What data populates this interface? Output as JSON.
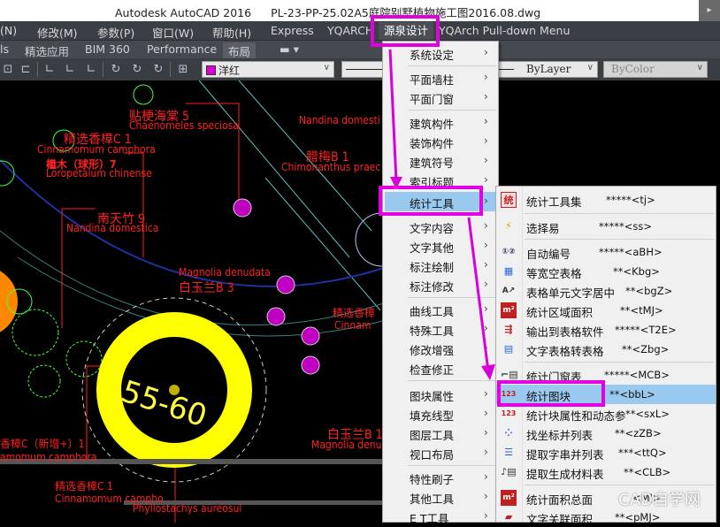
{
  "window": {
    "app_title": "Autodesk AutoCAD 2016",
    "file_name": "PL-23-PP-25.02A5庭院别墅植物施工图2016.08.dwg"
  },
  "menubar": {
    "items": [
      "(N)",
      "修改(M)",
      "参数(P)",
      "窗口(W)",
      "帮助(H)",
      "Express",
      "YQARCH",
      "源泉设计",
      "YQArch Pull-down Menu"
    ],
    "active": "源泉设计"
  },
  "ribbon_tabs": {
    "items": [
      "ls",
      "精选应用",
      "BIM 360",
      "Performance",
      "布局"
    ],
    "active": "布局"
  },
  "toolbar": {
    "layer_color": "洋红",
    "layer_color_hex": "#d600d6",
    "linetype": "ByLayer",
    "plot_style": "ByColor"
  },
  "main_menu": {
    "items": [
      {
        "label": "系统设定",
        "has_submenu": true
      },
      {
        "label": "平面墙柱",
        "has_submenu": true
      },
      {
        "label": "平面门窗",
        "has_submenu": true
      },
      {
        "label": "建筑构件",
        "has_submenu": true
      },
      {
        "label": "装饰构件",
        "has_submenu": true
      },
      {
        "label": "建筑符号",
        "has_submenu": true
      },
      {
        "label": "索引标题",
        "has_submenu": true
      },
      {
        "label": "统计工具",
        "has_submenu": true,
        "highlighted": true
      },
      {
        "label": "文字内容",
        "has_submenu": true
      },
      {
        "label": "文字其他",
        "has_submenu": true
      },
      {
        "label": "标注绘制",
        "has_submenu": true
      },
      {
        "label": "标注修改",
        "has_submenu": true
      },
      {
        "label": "曲线工具",
        "has_submenu": true
      },
      {
        "label": "特殊工具",
        "has_submenu": true
      },
      {
        "label": "修改增强",
        "has_submenu": true
      },
      {
        "label": "检查修正",
        "has_submenu": false
      },
      {
        "label": "图块属性",
        "has_submenu": true
      },
      {
        "label": "填充线型",
        "has_submenu": true
      },
      {
        "label": "图层工具",
        "has_submenu": true
      },
      {
        "label": "视口布局",
        "has_submenu": true
      },
      {
        "label": "特性刷子",
        "has_submenu": true
      },
      {
        "label": "其他工具",
        "has_submenu": true
      },
      {
        "label": "E T工具",
        "has_submenu": true
      }
    ],
    "arrow": "›"
  },
  "submenu": {
    "items": [
      {
        "label": "统计工具集",
        "shortcut": "*****<tj>",
        "icon": "stats-tool-icon"
      },
      {
        "label": "选择易",
        "shortcut": "*****<ss>",
        "icon": "lightning-select-icon"
      },
      {
        "label": "自动编号",
        "shortcut": "*****<aBH>",
        "icon": "auto-number-icon"
      },
      {
        "label": "等宽空表格",
        "shortcut": "**<Kbg>",
        "icon": "table-icon"
      },
      {
        "label": "表格单元文字居中",
        "shortcut": "**<bgZ>",
        "icon": "text-center-icon"
      },
      {
        "label": "统计区域面积",
        "shortcut": "**<tMJ>",
        "icon": "area-icon"
      },
      {
        "label": "输出到表格软件",
        "shortcut": "*****<T2E>",
        "icon": "export-table-icon"
      },
      {
        "label": "文字表格转表格",
        "shortcut": "**<Zbg>",
        "icon": "convert-table-icon"
      },
      {
        "label": "统计门窗表",
        "shortcut": "*****<MCB>",
        "icon": "door-window-icon"
      },
      {
        "label": "统计图块",
        "shortcut": "**<bbL>",
        "icon": "block-count-icon",
        "highlighted": true
      },
      {
        "label": "统计块属性和动态参",
        "shortcut": "**<sxL>",
        "icon": "block-attr-icon"
      },
      {
        "label": "找坐标并列表",
        "shortcut": "**<zZB>",
        "icon": "coordinate-list-icon"
      },
      {
        "label": "提取字串并列表",
        "shortcut": "***<ttQ>",
        "icon": "extract-string-icon"
      },
      {
        "label": "提取生成材料表",
        "shortcut": "**<CLB>",
        "icon": "material-table-icon"
      },
      {
        "label": "统计面积总面",
        "shortcut": "<MJ>",
        "icon": "total-area-icon"
      },
      {
        "label": "文字关联面积",
        "shortcut": "**<pMJ>",
        "icon": "text-area-icon"
      }
    ]
  },
  "drawing": {
    "labels": [
      {
        "text": "贴梗海棠 5",
        "color": "#ff2020"
      },
      {
        "text": "Chaenomeles speciosa",
        "color": "#ff2020"
      },
      {
        "text": "精选香樟C 1",
        "color": "#ff2020"
      },
      {
        "text": "Cinnamomum camphora",
        "color": "#ff2020"
      },
      {
        "text": "檵木（球形）7",
        "color": "#ff2020"
      },
      {
        "text": "Loropetalum chinense",
        "color": "#ff2020"
      },
      {
        "text": "南天竹 9",
        "color": "#ff2020"
      },
      {
        "text": "Nandina domestica",
        "color": "#ff2020"
      },
      {
        "text": "Nandina domesti",
        "color": "#ff2020"
      },
      {
        "text": "腊梅B 1",
        "color": "#ff2020"
      },
      {
        "text": "Chimonanthus praec",
        "color": "#ff2020"
      },
      {
        "text": "Magnolia denudata",
        "color": "#ff2020"
      },
      {
        "text": "白玉兰B 3",
        "color": "#ff2020"
      },
      {
        "text": "精选香樟",
        "color": "#ff2020"
      },
      {
        "text": "Cinnam",
        "color": "#ff2020"
      },
      {
        "text": "香樟C（新增+）1",
        "color": "#ff2020"
      },
      {
        "text": "amomum camphora",
        "color": "#ff2020"
      },
      {
        "text": "精选香樟C 1",
        "color": "#ff2020"
      },
      {
        "text": "Cinnamomum campho",
        "color": "#ff2020"
      },
      {
        "text": "Phyllostachys aureosul",
        "color": "#ff2020"
      },
      {
        "text": "白玉兰B 1",
        "color": "#ff2020"
      },
      {
        "text": "Magnolia denu",
        "color": "#ff2020"
      }
    ],
    "circle_label": "55-60",
    "circle_color": "#ffff00"
  },
  "watermark": {
    "text": "CAD自学网"
  }
}
